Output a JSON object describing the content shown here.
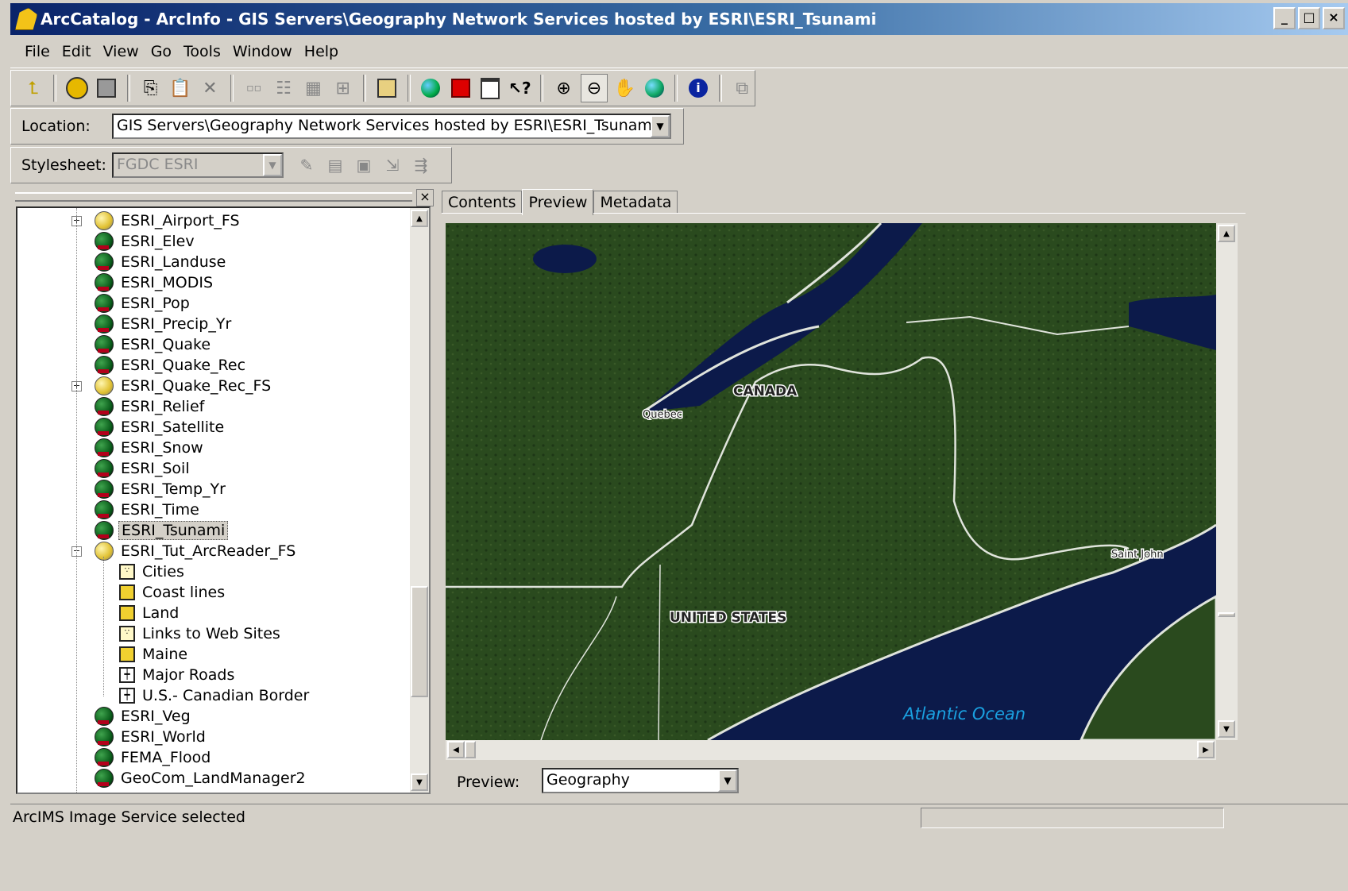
{
  "window": {
    "title": "ArcCatalog - ArcInfo - GIS Servers\\Geography Network Services hosted by ESRI\\ESRI_Tsunami"
  },
  "menu": [
    "File",
    "Edit",
    "View",
    "Go",
    "Tools",
    "Window",
    "Help"
  ],
  "location": {
    "label": "Location:",
    "value": "GIS Servers\\Geography Network Services hosted by ESRI\\ESRI_Tsunami"
  },
  "stylesheet": {
    "label": "Stylesheet:",
    "value": "FGDC ESRI"
  },
  "tabs": [
    {
      "label": "Contents",
      "active": false
    },
    {
      "label": "Preview",
      "active": true
    },
    {
      "label": "Metadata",
      "active": false
    }
  ],
  "tree": [
    {
      "label": "ESRI_Airport_FS",
      "type": "feature-service",
      "level": 0,
      "expander": "+"
    },
    {
      "label": "ESRI_Elev",
      "type": "image-service",
      "level": 0
    },
    {
      "label": "ESRI_Landuse",
      "type": "image-service",
      "level": 0
    },
    {
      "label": "ESRI_MODIS",
      "type": "image-service",
      "level": 0
    },
    {
      "label": "ESRI_Pop",
      "type": "image-service",
      "level": 0
    },
    {
      "label": "ESRI_Precip_Yr",
      "type": "image-service",
      "level": 0
    },
    {
      "label": "ESRI_Quake",
      "type": "image-service",
      "level": 0
    },
    {
      "label": "ESRI_Quake_Rec",
      "type": "image-service",
      "level": 0
    },
    {
      "label": "ESRI_Quake_Rec_FS",
      "type": "feature-service",
      "level": 0,
      "expander": "+"
    },
    {
      "label": "ESRI_Relief",
      "type": "image-service",
      "level": 0
    },
    {
      "label": "ESRI_Satellite",
      "type": "image-service",
      "level": 0
    },
    {
      "label": "ESRI_Snow",
      "type": "image-service",
      "level": 0
    },
    {
      "label": "ESRI_Soil",
      "type": "image-service",
      "level": 0
    },
    {
      "label": "ESRI_Temp_Yr",
      "type": "image-service",
      "level": 0
    },
    {
      "label": "ESRI_Time",
      "type": "image-service",
      "level": 0
    },
    {
      "label": "ESRI_Tsunami",
      "type": "image-service",
      "level": 0,
      "selected": true
    },
    {
      "label": "ESRI_Tut_ArcReader_FS",
      "type": "feature-service",
      "level": 0,
      "expander": "-"
    },
    {
      "label": "Cities",
      "type": "point-layer",
      "level": 1
    },
    {
      "label": "Coast lines",
      "type": "polygon-layer",
      "level": 1
    },
    {
      "label": "Land",
      "type": "polygon-layer",
      "level": 1
    },
    {
      "label": "Links to Web Sites",
      "type": "point-layer",
      "level": 1
    },
    {
      "label": "Maine",
      "type": "polygon-layer",
      "level": 1
    },
    {
      "label": "Major Roads",
      "type": "line-layer",
      "level": 1
    },
    {
      "label": "U.S.- Canadian Border",
      "type": "line-layer",
      "level": 1
    },
    {
      "label": "ESRI_Veg",
      "type": "image-service",
      "level": 0
    },
    {
      "label": "ESRI_World",
      "type": "image-service",
      "level": 0
    },
    {
      "label": "FEMA_Flood",
      "type": "image-service",
      "level": 0
    },
    {
      "label": "GeoCom_LandManager2",
      "type": "image-service",
      "level": 0
    }
  ],
  "map": {
    "labels": {
      "canada": "CANADA",
      "quebec": "Quebec",
      "usa": "UNITED STATES",
      "saint_john": "Saint John",
      "ocean": "Atlantic Ocean"
    },
    "colors": {
      "land": "#2a4a1e",
      "water": "#0c1a4a",
      "border": "#e0e4dc",
      "ocean_label": "#1aa0e0"
    }
  },
  "preview": {
    "label": "Preview:",
    "value": "Geography"
  },
  "status": {
    "text": "ArcIMS Image Service selected"
  }
}
